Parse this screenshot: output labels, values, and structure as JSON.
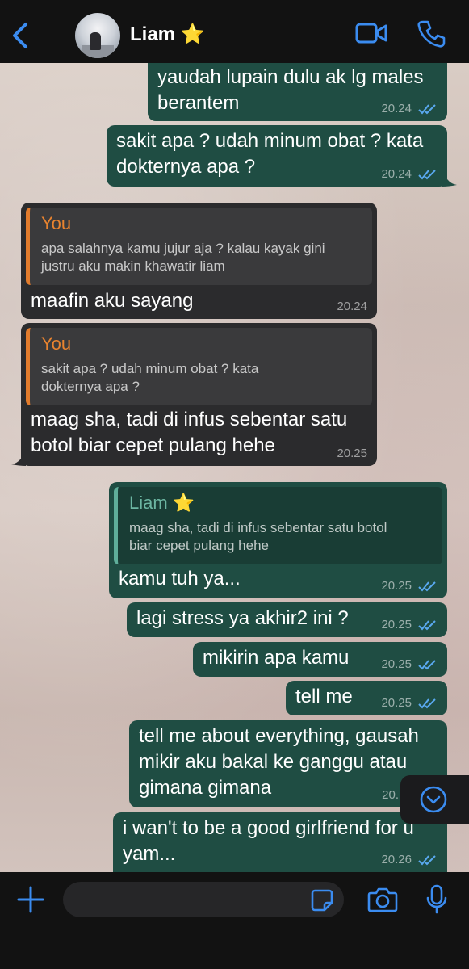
{
  "header": {
    "contact_name": "Liam ⭐",
    "back_icon": "chevron-left-icon",
    "video_icon": "video-camera-icon",
    "call_icon": "phone-icon",
    "accent": "#3b8cf0"
  },
  "messages": [
    {
      "dir": "out",
      "lines": [
        "yaudah lupain dulu ak lg males",
        "berantem"
      ],
      "time": "20.24",
      "read": true
    },
    {
      "dir": "out",
      "lines": [
        "sakit apa ? udah minum obat ? kata",
        "dokternya apa ?"
      ],
      "time": "20.24",
      "read": true
    },
    {
      "dir": "in",
      "quote": {
        "author": "You",
        "lines": [
          "apa salahnya kamu jujur aja ? kalau kayak gini",
          "justru aku makin khawatir liam"
        ]
      },
      "lines": [
        "maafin aku sayang"
      ],
      "time": "20.24"
    },
    {
      "dir": "in",
      "quote": {
        "author": "You",
        "lines": [
          "sakit apa ? udah minum obat ? kata",
          "dokternya apa ?"
        ]
      },
      "lines": [
        "maag sha, tadi di infus sebentar satu",
        "botol biar cepet pulang hehe"
      ],
      "time": "20.25"
    },
    {
      "dir": "out",
      "quote": {
        "author": "Liam ⭐",
        "lines": [
          "maag sha, tadi di infus sebentar satu botol",
          "biar cepet pulang hehe"
        ]
      },
      "lines": [
        "kamu tuh ya..."
      ],
      "time": "20.25",
      "read": true
    },
    {
      "dir": "out",
      "lines": [
        "lagi stress ya akhir2 ini ?"
      ],
      "time": "20.25",
      "read": true
    },
    {
      "dir": "out",
      "lines": [
        "mikirin apa kamu"
      ],
      "time": "20.25",
      "read": true
    },
    {
      "dir": "out",
      "lines": [
        "tell me"
      ],
      "time": "20.25",
      "read": true
    },
    {
      "dir": "out",
      "lines": [
        "tell me about everything, gausah",
        "mikir aku bakal ke ganggu atau",
        "gimana gimana"
      ],
      "time": "20.",
      "read": true
    },
    {
      "dir": "out",
      "lines": [
        "i wan't to be a good girlfriend for u",
        "yam..."
      ],
      "time": "20.26",
      "read": true
    }
  ],
  "footer": {
    "add_icon": "plus-icon",
    "sticker_icon": "sticker-icon",
    "camera_icon": "camera-icon",
    "mic_icon": "microphone-icon",
    "input_value": ""
  },
  "scroll_down_icon": "chevron-down-circle-icon",
  "colors": {
    "outgoing": "#1f4d43",
    "incoming": "#2b2b2d",
    "read_tick": "#5aa9f0",
    "quote_you": "#e8832f",
    "quote_liam": "#6cb6a2"
  }
}
